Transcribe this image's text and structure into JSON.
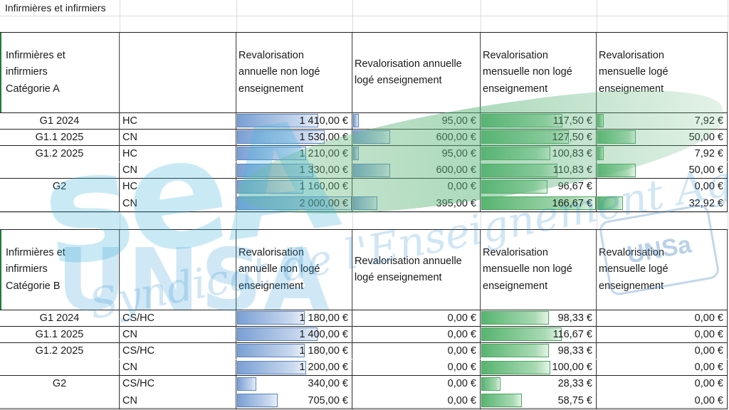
{
  "sheet_title": "Infirmières et infirmiers",
  "headers": {
    "col3": [
      "Revalorisation",
      "annuelle non logé",
      "enseignement"
    ],
    "col4": [
      "Revalorisation annuelle",
      "logé enseignement"
    ],
    "col5": [
      "Revalorisation",
      "mensuelle non logé",
      "enseignement"
    ],
    "col6": [
      "Revalorisation",
      "mensuelle logé",
      "enseignement"
    ]
  },
  "tables": [
    {
      "category": [
        "Infirmières et",
        "infirmiers",
        "Catégorie A"
      ],
      "rows": [
        {
          "grade": "G1 2024",
          "type": "HC",
          "v1": "1 410,00 €",
          "v2": "95,00 €",
          "v3": "117,50 €",
          "v4": "7,92 €",
          "f1": 0.705,
          "f2": 0.158,
          "f3": 0.705,
          "f4": 0.158
        },
        {
          "grade": "G1.1 2025",
          "type": "CN",
          "v1": "1 530,00 €",
          "v2": "600,00 €",
          "v3": "127,50 €",
          "v4": "50,00 €",
          "f1": 0.765,
          "f2": 1.0,
          "f3": 0.765,
          "f4": 1.0
        },
        {
          "grade": "G1.2 2025",
          "type": "HC",
          "v1": "1 210,00 €",
          "v2": "95,00 €",
          "v3": "100,83 €",
          "v4": "7,92 €",
          "f1": 0.605,
          "f2": 0.158,
          "f3": 0.605,
          "f4": 0.158
        },
        {
          "grade": "",
          "type": "CN",
          "v1": "1 330,00 €",
          "v2": "600,00 €",
          "v3": "110,83 €",
          "v4": "50,00 €",
          "f1": 0.665,
          "f2": 1.0,
          "f3": 0.665,
          "f4": 1.0
        },
        {
          "grade": "G2",
          "type": "HC",
          "v1": "1 160,00 €",
          "v2": "0,00 €",
          "v3": "96,67 €",
          "v4": "0,00 €",
          "f1": 0.58,
          "f2": 0,
          "f3": 0.58,
          "f4": 0
        },
        {
          "grade": "",
          "type": "CN",
          "v1": "2 000,00 €",
          "v2": "395,00 €",
          "v3": "166,67 €",
          "v4": "32,92 €",
          "f1": 1.0,
          "f2": 0.658,
          "f3": 1.0,
          "f4": 0.658
        }
      ]
    },
    {
      "category": [
        "Infirmières et",
        "infirmiers",
        "Catégorie B"
      ],
      "rows": [
        {
          "grade": "G1 2024",
          "type": "CS/HC",
          "v1": "1 180,00 €",
          "v2": "0,00 €",
          "v3": "98,33 €",
          "v4": "0,00 €",
          "f1": 0.59,
          "f2": 0,
          "f3": 0.59,
          "f4": 0
        },
        {
          "grade": "G1.1 2025",
          "type": "CN",
          "v1": "1 400,00 €",
          "v2": "0,00 €",
          "v3": "116,67 €",
          "v4": "0,00 €",
          "f1": 0.7,
          "f2": 0,
          "f3": 0.7,
          "f4": 0
        },
        {
          "grade": "G1.2 2025",
          "type": "CS/HC",
          "v1": "1 180,00 €",
          "v2": "0,00 €",
          "v3": "98,33 €",
          "v4": "0,00 €",
          "f1": 0.59,
          "f2": 0,
          "f3": 0.59,
          "f4": 0
        },
        {
          "grade": "",
          "type": "CN",
          "v1": "1 200,00 €",
          "v2": "0,00 €",
          "v3": "100,00 €",
          "v4": "0,00 €",
          "f1": 0.6,
          "f2": 0,
          "f3": 0.6,
          "f4": 0
        },
        {
          "grade": "G2",
          "type": "CS/HC",
          "v1": "340,00 €",
          "v2": "0,00 €",
          "v3": "28,33 €",
          "v4": "0,00 €",
          "f1": 0.17,
          "f2": 0,
          "f3": 0.17,
          "f4": 0
        },
        {
          "grade": "",
          "type": "CN",
          "v1": "705,00 €",
          "v2": "0,00 €",
          "v3": "58,75 €",
          "v4": "0,00 €",
          "f1": 0.3525,
          "f2": 0,
          "f3": 0.3525,
          "f4": 0
        }
      ]
    }
  ],
  "watermark": {
    "big": "seA",
    "org": "UNSA",
    "subtitle": "Syndicat de l'Enseignement Agricole",
    "logo": "UNSa"
  },
  "colors": {
    "blue_bar": "#7aa0d4",
    "green_bar": "#58b470",
    "accent_green": "#1f7a3a"
  }
}
